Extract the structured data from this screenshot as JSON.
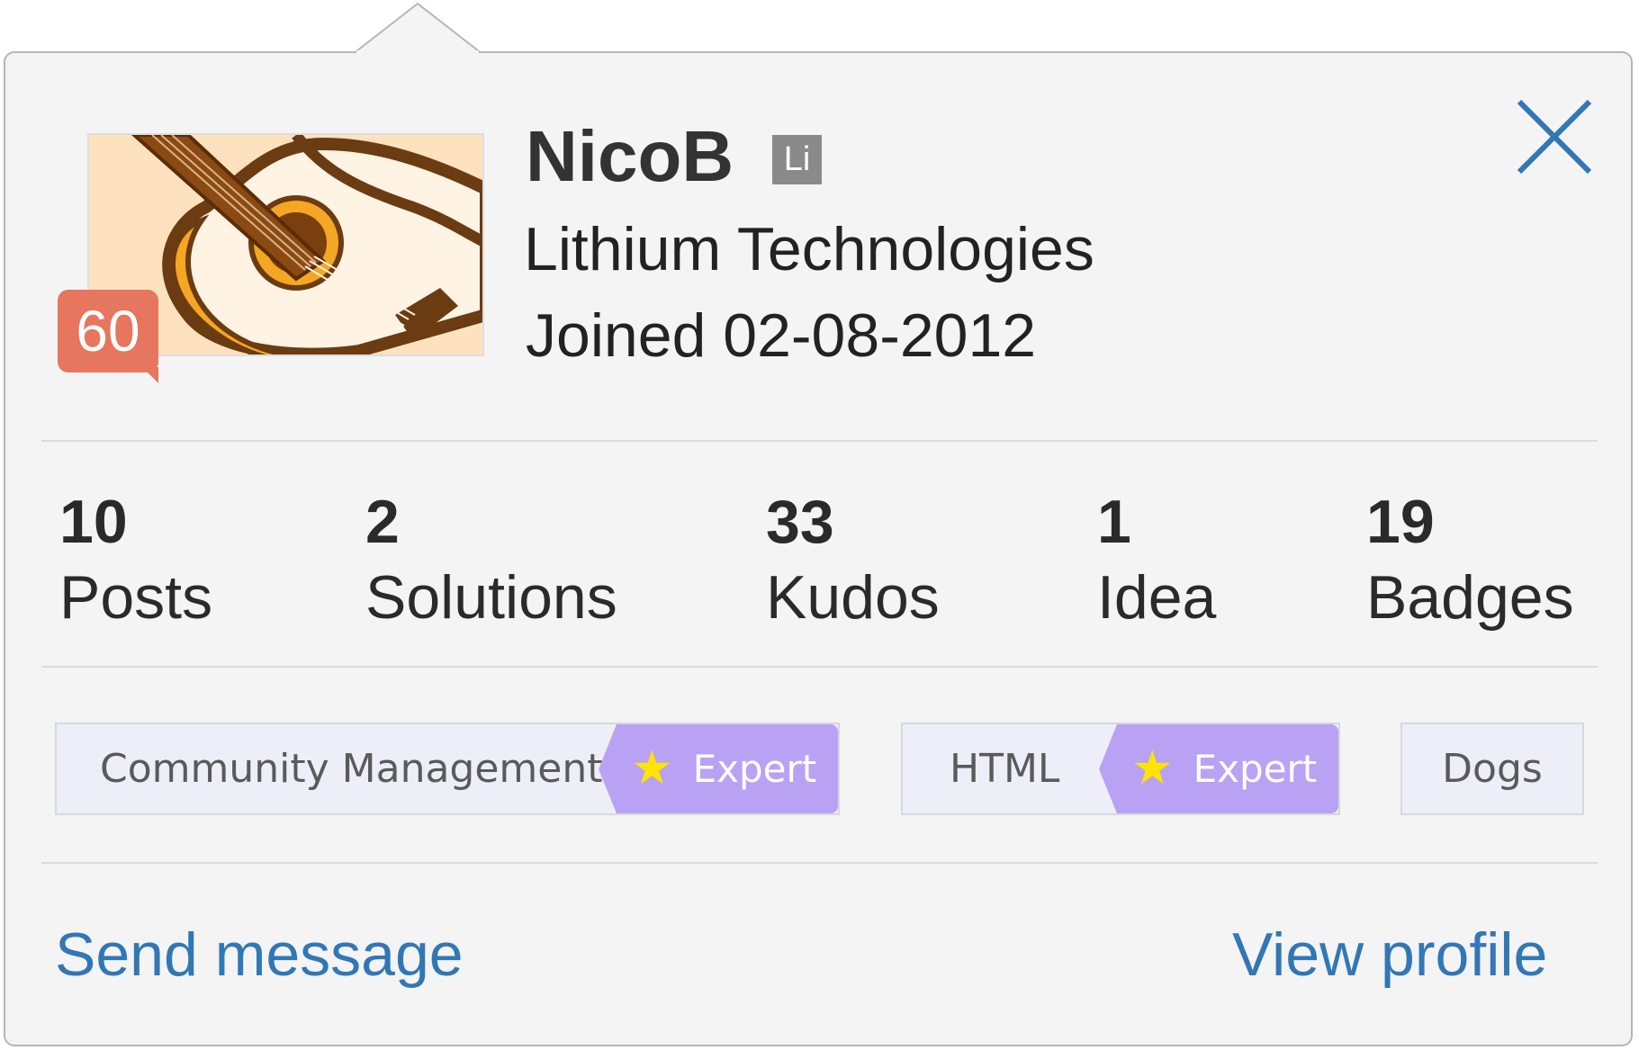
{
  "profile": {
    "name": "NicoB",
    "company_badge": "Li",
    "company": "Lithium Technologies",
    "joined": "Joined 02-08-2012",
    "rank": "60"
  },
  "stats": [
    {
      "count": "10",
      "label": "Posts"
    },
    {
      "count": "2",
      "label": "Solutions"
    },
    {
      "count": "33",
      "label": "Kudos"
    },
    {
      "count": "1",
      "label": "Idea"
    },
    {
      "count": "19",
      "label": "Badges"
    }
  ],
  "tags": [
    {
      "label": "Community Management",
      "badge": "Expert"
    },
    {
      "label": "HTML",
      "badge": "Expert"
    },
    {
      "label": "Dogs"
    }
  ],
  "actions": {
    "send_message": "Send message",
    "view_profile": "View profile"
  },
  "icons": {
    "close": "close-icon",
    "star": "star-icon"
  },
  "colors": {
    "link": "#3277b5",
    "close": "#3277b5",
    "rank_badge": "#e7765f",
    "expert_badge": "#b9a2f3",
    "star": "#ffe400",
    "card_bg": "#f4f4f4"
  }
}
